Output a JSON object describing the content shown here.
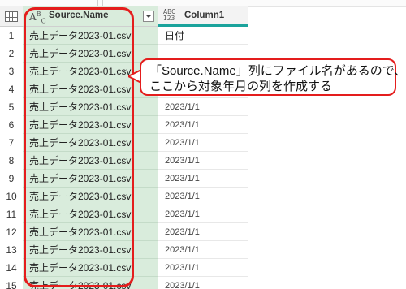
{
  "header": {
    "source_col_label": "Source.Name",
    "source_type": "ABC",
    "col1_label": "Column1",
    "col1_type": "ABC 123"
  },
  "rows": [
    {
      "num": "1",
      "source": "売上データ2023-01.csv",
      "col1": "日付"
    },
    {
      "num": "2",
      "source": "売上データ2023-01.csv",
      "col1": ""
    },
    {
      "num": "3",
      "source": "売上データ2023-01.csv",
      "col1": ""
    },
    {
      "num": "4",
      "source": "売上データ2023-01.csv",
      "col1": "2023/1/1"
    },
    {
      "num": "5",
      "source": "売上データ2023-01.csv",
      "col1": "2023/1/1"
    },
    {
      "num": "6",
      "source": "売上データ2023-01.csv",
      "col1": "2023/1/1"
    },
    {
      "num": "7",
      "source": "売上データ2023-01.csv",
      "col1": "2023/1/1"
    },
    {
      "num": "8",
      "source": "売上データ2023-01.csv",
      "col1": "2023/1/1"
    },
    {
      "num": "9",
      "source": "売上データ2023-01.csv",
      "col1": "2023/1/1"
    },
    {
      "num": "10",
      "source": "売上データ2023-01.csv",
      "col1": "2023/1/1"
    },
    {
      "num": "11",
      "source": "売上データ2023-01.csv",
      "col1": "2023/1/1"
    },
    {
      "num": "12",
      "source": "売上データ2023-01.csv",
      "col1": "2023/1/1"
    },
    {
      "num": "13",
      "source": "売上データ2023-01.csv",
      "col1": "2023/1/1"
    },
    {
      "num": "14",
      "source": "売上データ2023-01.csv",
      "col1": "2023/1/1"
    },
    {
      "num": "15",
      "source": "売上データ2023-01.csv",
      "col1": "2023/1/1"
    }
  ],
  "callout": {
    "line1": "「Source.Name」列にファイル名があるので、",
    "line2": "ここから対象年月の列を作成する"
  },
  "colors": {
    "accent_red": "#e41d1d",
    "column_highlight": "#d9ecdc",
    "header_teal": "#1ba39c"
  }
}
